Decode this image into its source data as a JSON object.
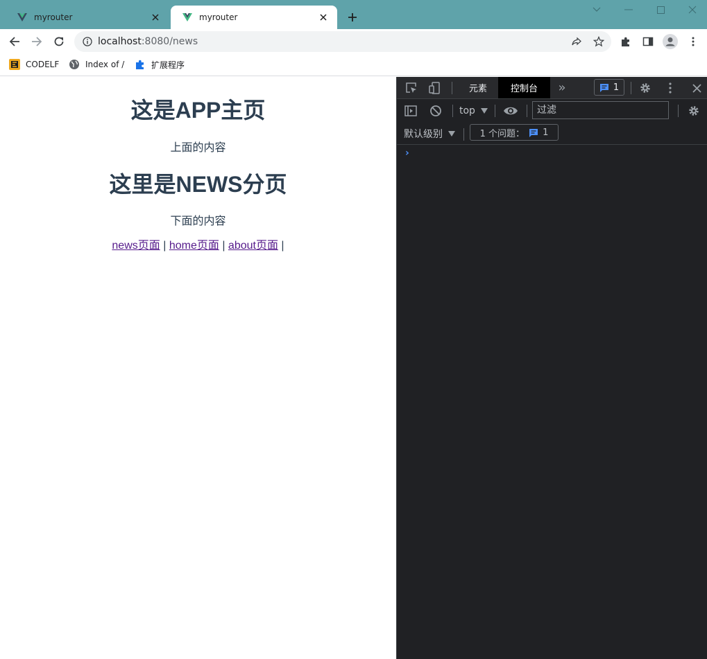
{
  "browser": {
    "tabs": [
      {
        "title": "myrouter",
        "active": false
      },
      {
        "title": "myrouter",
        "active": true
      }
    ],
    "url_host": "localhost",
    "url_rest": ":8080/news",
    "bookmarks": [
      {
        "label": "CODELF",
        "icon": "codelf-icon"
      },
      {
        "label": "Index of /",
        "icon": "globe-icon"
      },
      {
        "label": "扩展程序",
        "icon": "puzzle-icon"
      }
    ],
    "colors": {
      "tabstrip": "#5fa3aa",
      "vue_green": "#41b883",
      "vue_dark": "#35495e"
    }
  },
  "page": {
    "app_title": "这是APP主页",
    "top_text": "上面的内容",
    "news_title": "这里是NEWS分页",
    "bottom_text": "下面的内容",
    "links": [
      {
        "label": "news页面"
      },
      {
        "label": "home页面"
      },
      {
        "label": "about页面"
      }
    ],
    "separator": "|"
  },
  "devtools": {
    "tabs": [
      {
        "label": "元素",
        "active": false
      },
      {
        "label": "控制台",
        "active": true
      }
    ],
    "more": "»",
    "issue_badge_count": "1",
    "context": "top",
    "filter_placeholder": "过滤",
    "levels": "默认级别",
    "issues_label": "1 个问题：",
    "issues_count": "1",
    "prompt": "›"
  }
}
